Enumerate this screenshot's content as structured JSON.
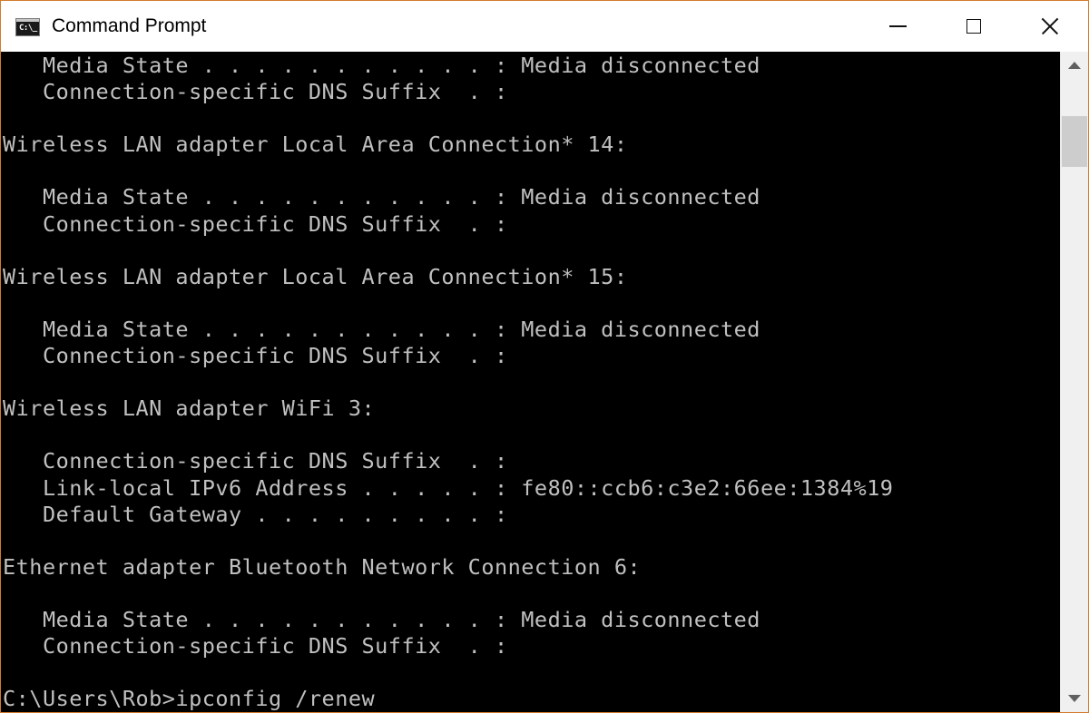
{
  "window": {
    "title": "Command Prompt",
    "icon": "cmd-icon",
    "icon_text": "C:\\_",
    "controls": {
      "minimize": "minimize-icon",
      "maximize": "maximize-icon",
      "close": "close-icon"
    },
    "border_color": "#d27b2a"
  },
  "console": {
    "background": "#000000",
    "foreground": "#c0c0c0",
    "lines": [
      "   Media State . . . . . . . . . . . : Media disconnected",
      "   Connection-specific DNS Suffix  . :",
      "",
      "Wireless LAN adapter Local Area Connection* 14:",
      "",
      "   Media State . . . . . . . . . . . : Media disconnected",
      "   Connection-specific DNS Suffix  . :",
      "",
      "Wireless LAN adapter Local Area Connection* 15:",
      "",
      "   Media State . . . . . . . . . . . : Media disconnected",
      "   Connection-specific DNS Suffix  . :",
      "",
      "Wireless LAN adapter WiFi 3:",
      "",
      "   Connection-specific DNS Suffix  . :",
      "   Link-local IPv6 Address . . . . . : fe80::ccb6:c3e2:66ee:1384%19",
      "   Default Gateway . . . . . . . . . :",
      "",
      "Ethernet adapter Bluetooth Network Connection 6:",
      "",
      "   Media State . . . . . . . . . . . : Media disconnected",
      "   Connection-specific DNS Suffix  . :",
      "",
      "C:\\Users\\Rob>ipconfig /renew"
    ]
  },
  "scrollbar": {
    "up_icon": "chevron-up-icon",
    "down_icon": "chevron-down-icon"
  }
}
